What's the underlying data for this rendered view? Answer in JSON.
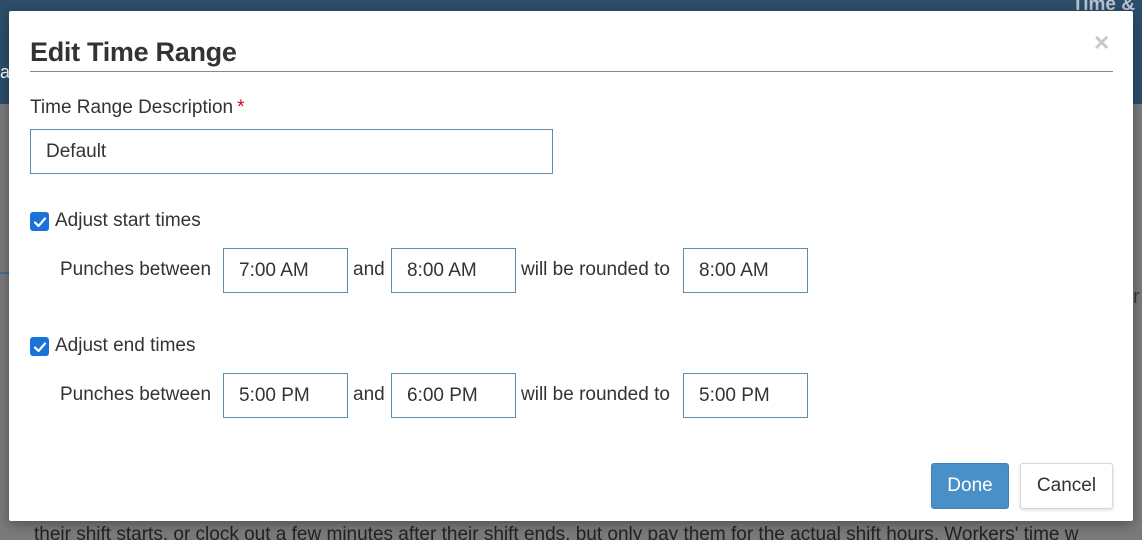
{
  "background": {
    "header_title_fragment": "Time &",
    "left_fragment": "a",
    "right_fragment": "r",
    "bottom_text": "their shift starts, or clock out a few minutes after their shift ends, but only pay them for the actual shift hours. Workers' time w"
  },
  "modal": {
    "title": "Edit Time Range",
    "close_glyph": "×"
  },
  "description_field": {
    "label": "Time Range Description",
    "required_mark": "*",
    "value": "Default"
  },
  "start_times": {
    "checkbox_label": "Adjust start times",
    "checked": true,
    "prefix": "Punches between",
    "from": "7:00 AM",
    "conjunction": "and",
    "to": "8:00 AM",
    "rounded_label": "will be rounded to",
    "rounded_to": "8:00 AM"
  },
  "end_times": {
    "checkbox_label": "Adjust end times",
    "checked": true,
    "prefix": "Punches between",
    "from": "5:00 PM",
    "conjunction": "and",
    "to": "6:00 PM",
    "rounded_label": "will be rounded to",
    "rounded_to": "5:00 PM"
  },
  "actions": {
    "done_label": "Done",
    "cancel_label": "Cancel"
  },
  "colors": {
    "primary_button": "#4a90c8",
    "checkbox": "#1a73d9",
    "required": "#d0021b",
    "input_border": "#5d8fa8"
  }
}
